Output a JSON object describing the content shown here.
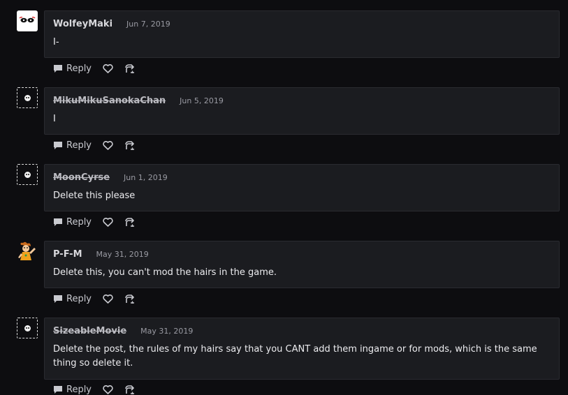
{
  "comments": [
    {
      "author": "WolfeyMaki",
      "date": "Jun 7, 2019",
      "text": "I-",
      "avatar": "white-glyph-avatar",
      "deleted": false
    },
    {
      "author": "MikuMikuSanokaChan",
      "date": "Jun 5, 2019",
      "text": "I",
      "avatar": "default-avatar",
      "deleted": true
    },
    {
      "author": "MoonCyrse",
      "date": "Jun 1, 2019",
      "text": "Delete this please",
      "avatar": "default-avatar",
      "deleted": true
    },
    {
      "author": "P-F-M",
      "date": "May 31, 2019",
      "text": "Delete this, you can't mod the hairs in the game.",
      "avatar": "character-avatar",
      "deleted": false
    },
    {
      "author": "SizeableMovie",
      "date": "May 31, 2019",
      "text": "Delete the post, the rules of my hairs say that you CANT add them ingame or for mods, which is the same thing so delete it.",
      "avatar": "default-avatar",
      "deleted": true
    }
  ],
  "actions": {
    "reply_label": "Reply",
    "like_icon": "heart-icon",
    "share_icon": "share-icon"
  },
  "colors": {
    "background": "#0d0d10",
    "bubble": "#1b1c20",
    "border": "#2a2b30",
    "muted": "#9a9ba3"
  }
}
